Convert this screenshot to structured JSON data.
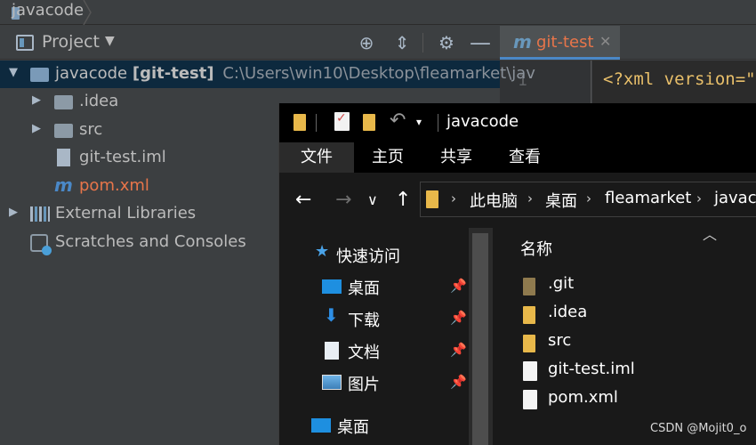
{
  "ide": {
    "breadcrumb": "javacode",
    "project_panel": {
      "title": "Project"
    },
    "editor_tab": {
      "name": "git-test"
    },
    "editor": {
      "line_number": "1",
      "code": "<?xml version=\""
    },
    "tree": [
      {
        "label": "javacode",
        "branch": "[git-test]",
        "path": "C:\\Users\\win10\\Desktop\\fleamarket\\jav"
      },
      {
        "label": ".idea"
      },
      {
        "label": "src"
      },
      {
        "label": "git-test.iml"
      },
      {
        "label": "pom.xml"
      },
      {
        "label": "External Libraries"
      },
      {
        "label": "Scratches and Consoles"
      }
    ],
    "colors": {
      "accent": "#4a88c7",
      "modified": "#e8754a",
      "selection": "#0d293e"
    }
  },
  "explorer": {
    "window_title": "javacode",
    "ribbon_tabs": [
      "文件",
      "主页",
      "共享",
      "查看"
    ],
    "address": [
      "此电脑",
      "桌面",
      "fleamarket",
      "javaco"
    ],
    "nav_pane": [
      "快速访问",
      "桌面",
      "下载",
      "文档",
      "图片",
      "桌面"
    ],
    "column_header": "名称",
    "files": [
      ".git",
      ".idea",
      "src",
      "git-test.iml",
      "pom.xml"
    ]
  },
  "watermark": "CSDN @Mojit0_o"
}
